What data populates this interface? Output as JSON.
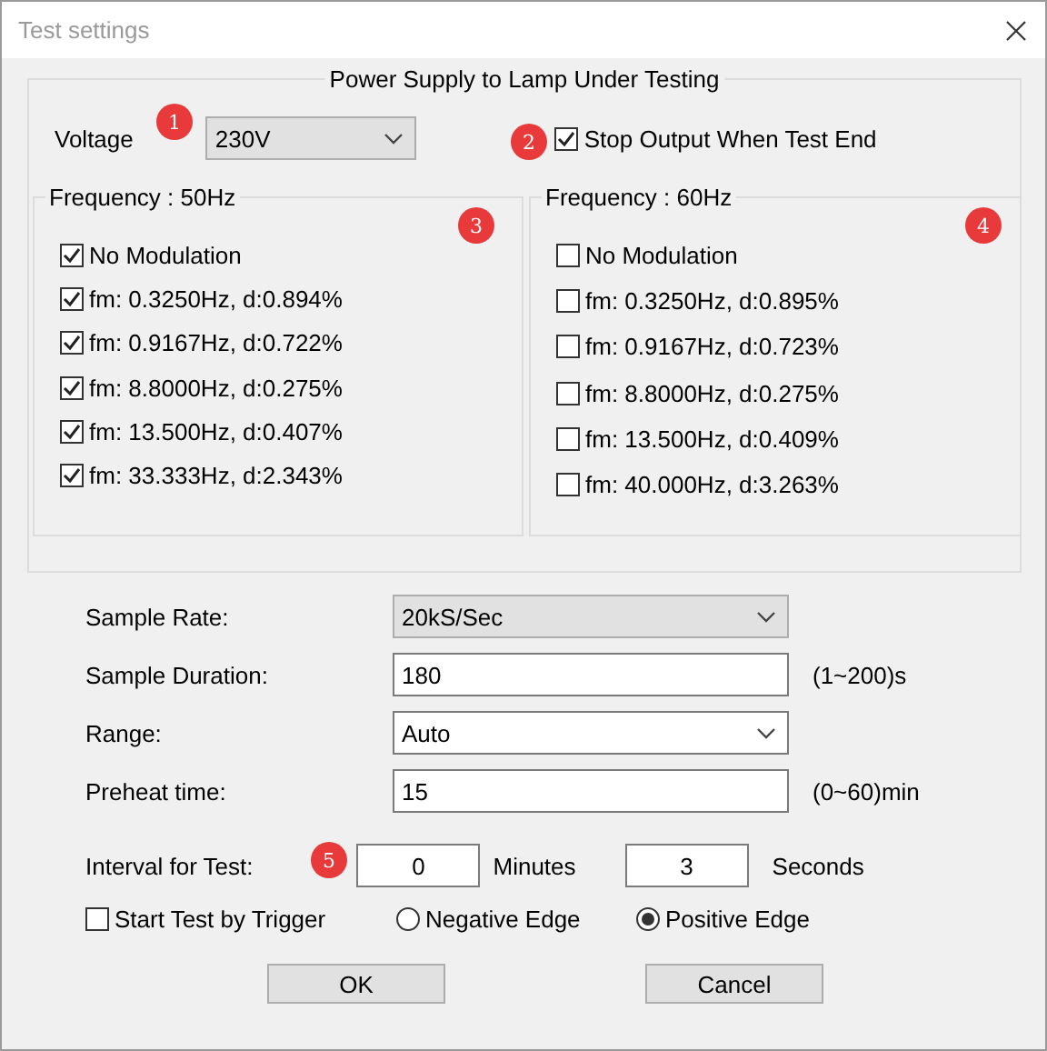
{
  "window": {
    "title": "Test settings"
  },
  "power_supply": {
    "title": "Power Supply to Lamp Under Testing",
    "voltage_label": "Voltage",
    "voltage_badge": "1",
    "voltage_value": "230V",
    "stop_output": {
      "label": "Stop Output When Test End",
      "checked": true,
      "badge": "2"
    },
    "frequency_groups": [
      {
        "title": "Frequency : 50Hz",
        "badge": "3",
        "items": [
          {
            "label": "No Modulation",
            "checked": true
          },
          {
            "label": "fm: 0.3250Hz, d:0.894%",
            "checked": true
          },
          {
            "label": "fm: 0.9167Hz, d:0.722%",
            "checked": true
          },
          {
            "label": "fm: 8.8000Hz, d:0.275%",
            "checked": true
          },
          {
            "label": "fm: 13.500Hz, d:0.407%",
            "checked": true
          },
          {
            "label": "fm: 33.333Hz, d:2.343%",
            "checked": true
          }
        ]
      },
      {
        "title": "Frequency : 60Hz",
        "badge": "4",
        "items": [
          {
            "label": "No Modulation",
            "checked": false
          },
          {
            "label": "fm: 0.3250Hz, d:0.895%",
            "checked": false
          },
          {
            "label": "fm: 0.9167Hz, d:0.723%",
            "checked": false
          },
          {
            "label": "fm: 8.8000Hz, d:0.275%",
            "checked": false
          },
          {
            "label": "fm: 13.500Hz, d:0.409%",
            "checked": false
          },
          {
            "label": "fm: 40.000Hz, d:3.263%",
            "checked": false
          }
        ]
      }
    ]
  },
  "fields": [
    {
      "kind": "select",
      "label": "Sample Rate:",
      "value": "20kS/Sec",
      "shaded": true
    },
    {
      "kind": "input",
      "label": "Sample Duration:",
      "value": "180",
      "unit": "(1~200)s"
    },
    {
      "kind": "select",
      "label": "Range:",
      "value": "Auto",
      "shaded": false
    },
    {
      "kind": "input",
      "label": "Preheat time:",
      "value": "15",
      "unit": "(0~60)min"
    }
  ],
  "interval": {
    "label": "Interval for Test:",
    "badge": "5",
    "minutes_value": "0",
    "minutes_label": "Minutes",
    "seconds_value": "3",
    "seconds_label": "Seconds"
  },
  "trigger": {
    "label": "Start Test by Trigger",
    "checked": false
  },
  "edges": [
    {
      "label": "Negative Edge",
      "selected": false
    },
    {
      "label": "Positive Edge",
      "selected": true
    }
  ],
  "buttons": [
    "OK",
    "Cancel"
  ]
}
